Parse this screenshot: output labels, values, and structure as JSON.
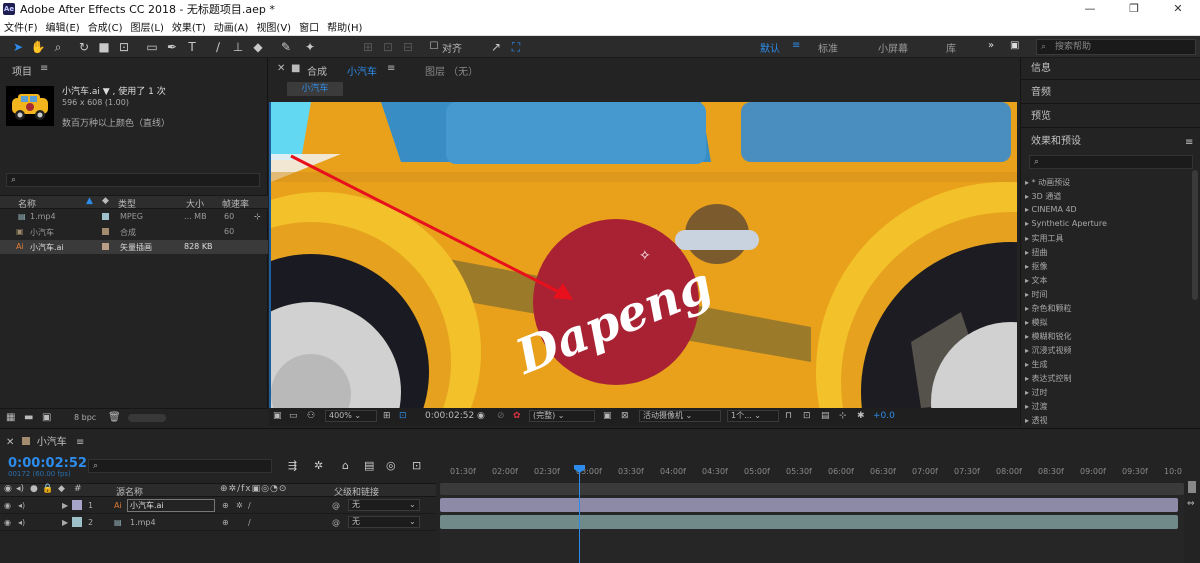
{
  "window": {
    "title": "Adobe After Effects CC 2018 - 无标题项目.aep *",
    "logo": "Ae"
  },
  "menu": [
    "文件(F)",
    "编辑(E)",
    "合成(C)",
    "图层(L)",
    "效果(T)",
    "动画(A)",
    "视图(V)",
    "窗口",
    "帮助(H)"
  ],
  "toolbar": {
    "align_label": "对齐",
    "workspaces": [
      "默认",
      "标准",
      "小屏幕",
      "库"
    ],
    "active_workspace": "默认",
    "search_placeholder": "搜索帮助"
  },
  "project": {
    "tab": "项目",
    "selected_name": "小汽车.ai ▼ , 使用了 1 次",
    "dims": "596 x 608 (1.00)",
    "color_info": "数百万种以上颜色（直线）",
    "search_placeholder": "",
    "columns": {
      "name": "名称",
      "type": "类型",
      "size": "大小",
      "fps": "帧速率"
    },
    "items": [
      {
        "name": "1.mp4",
        "color": "#9ec0c8",
        "type": "MPEG",
        "size": "... MB",
        "fps": "60"
      },
      {
        "name": "小汽车",
        "color": "#a38b6d",
        "type": "合成",
        "size": "",
        "fps": "60"
      },
      {
        "name": "小汽车.ai",
        "color": "#b89f86",
        "type": "矢量插画",
        "size": "828 KB",
        "fps": ""
      }
    ],
    "bpc": "8 bpc"
  },
  "comp": {
    "tab_prefix": "合成",
    "tab_name": "小汽车",
    "layer_tab": "图层 （无）",
    "name_pill": "小汽车",
    "overlay_text": "Dapeng",
    "zoom": "400%",
    "timecode": "0:00:02:52",
    "resolution": "(完整)",
    "camera": "活动摄像机",
    "views": "1个...",
    "exposure": "+0.0"
  },
  "right_panels": {
    "info": "信息",
    "audio": "音频",
    "preview": "预览",
    "effects": "效果和预设",
    "fx_search": "",
    "fx_items": [
      "▸ * 动画预设",
      "▸ 3D 通道",
      "▸ CINEMA 4D",
      "▸ Synthetic Aperture",
      "▸ 实用工具",
      "▸ 扭曲",
      "▸ 抠像",
      "▸ 文本",
      "▸ 时间",
      "▸ 杂色和颗粒",
      "▸ 模拟",
      "▸ 模糊和锐化",
      "▸ 沉浸式视频",
      "▸ 生成",
      "▸ 表达式控制",
      "▸ 过时",
      "▸ 过渡",
      "▸ 透视"
    ]
  },
  "timeline": {
    "tab": "小汽车",
    "timecode": "0:00:02:52",
    "fps_info": "00172 (60.00 fps)",
    "search_placeholder": "",
    "col_name": "源名称",
    "col_parent": "父级和链接",
    "layers": [
      {
        "num": "1",
        "name": "小汽车.ai",
        "parent": "无",
        "color": "#a7a4c9",
        "bar_color": "#8d8aa8"
      },
      {
        "num": "2",
        "name": "1.mp4",
        "parent": "无",
        "color": "#9ec0c8",
        "bar_color": "#6f8a88"
      }
    ],
    "ticks": [
      "01:30f",
      "02:00f",
      "02:30f",
      "03:00f",
      "03:30f",
      "04:00f",
      "04:30f",
      "05:00f",
      "05:30f",
      "06:00f",
      "06:30f",
      "07:00f",
      "07:30f",
      "08:00f",
      "08:30f",
      "09:00f",
      "09:30f",
      "10:0"
    ]
  }
}
